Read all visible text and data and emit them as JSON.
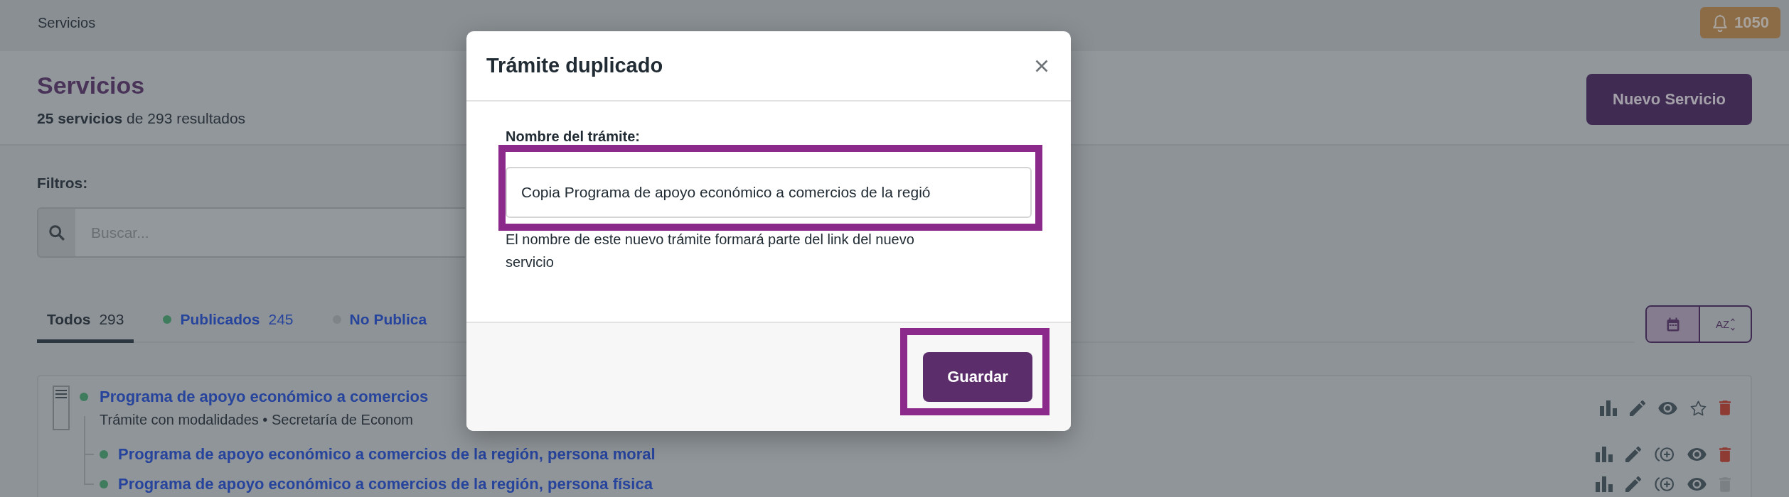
{
  "top_bar": {
    "title": "Servicios",
    "notifications": "1050"
  },
  "header": {
    "title": "Servicios",
    "summary": "**25 servicios** de 293 resultados",
    "primary_button": "Nuevo Servicio"
  },
  "filters": {
    "label": "Filtros:",
    "search": {
      "placeholder": "Buscar..."
    }
  },
  "tabs": [
    {
      "label": "Todos",
      "count": "293",
      "selected": true
    },
    {
      "label": "Publicados",
      "count": "245",
      "selected": false,
      "color": "#3f7c5e"
    },
    {
      "label": "No Publica",
      "selected": false,
      "color": "#7f8488"
    }
  ],
  "sort_toggle": [
    {
      "kind": "date",
      "selected": true
    },
    {
      "kind": "alphabetical",
      "label": "AZ",
      "selected": false
    }
  ],
  "services": [
    {
      "title": "Programa de apoyo económico a comercios",
      "meta": "Trámite con modalidades • Secretaría de Econom",
      "published": true,
      "starred": false,
      "delete_disabled": false,
      "children": [
        {
          "title": "Programa de apoyo económico a comercios de la región, persona moral",
          "published": true,
          "delete_disabled": false
        },
        {
          "title": "Programa de apoyo económico a comercios de la región, persona física",
          "published": true,
          "delete_disabled": true
        }
      ]
    }
  ],
  "modal": {
    "title": "Trámite duplicado",
    "field": {
      "label": "Nombre del trámite:",
      "value": "Copia Programa de apoyo económico a comercios de la regió",
      "highlighted": true
    },
    "help": "El nombre de este nuevo trámite formará parte del link del nuevo servicio",
    "buttons": [
      {
        "label": "Guardar",
        "highlighted": true
      }
    ]
  }
}
